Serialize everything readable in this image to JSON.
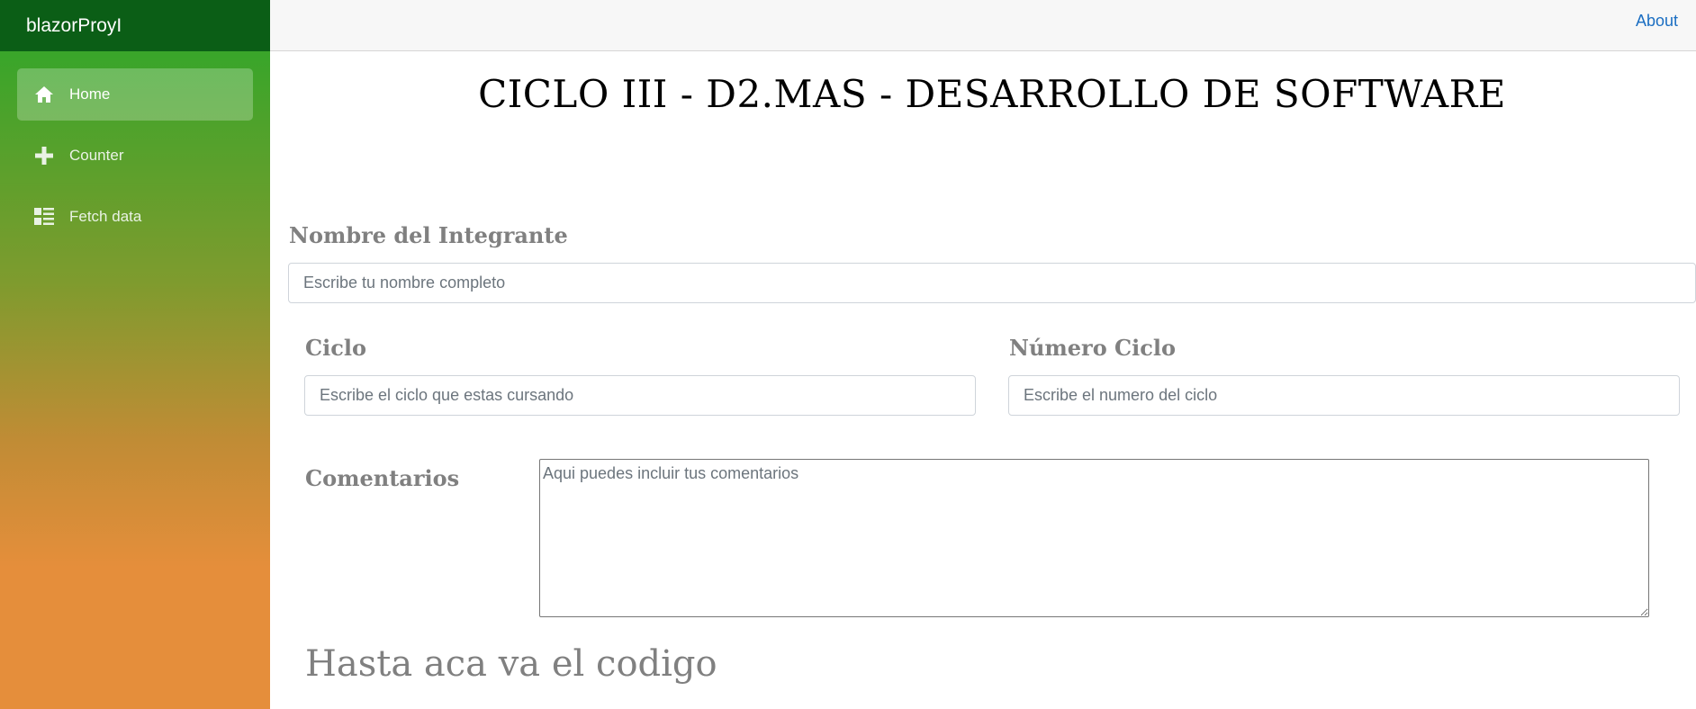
{
  "app": {
    "brand": "blazorProyI"
  },
  "sidebar": {
    "items": [
      {
        "label": "Home",
        "icon": "home-icon",
        "active": true
      },
      {
        "label": "Counter",
        "icon": "plus-icon",
        "active": false
      },
      {
        "label": "Fetch data",
        "icon": "list-icon",
        "active": false
      }
    ]
  },
  "topbar": {
    "about_label": "About"
  },
  "main": {
    "title": "CICLO III - D2.MAS - DESARROLLO DE SOFTWARE",
    "nombre": {
      "label": "Nombre del Integrante",
      "placeholder": "Escribe tu nombre completo",
      "value": ""
    },
    "ciclo": {
      "label": "Ciclo",
      "placeholder": "Escribe el ciclo que estas cursando",
      "value": ""
    },
    "numero_ciclo": {
      "label": "Número Ciclo",
      "placeholder": "Escribe el numero del ciclo",
      "value": ""
    },
    "comentarios": {
      "label": "Comentarios",
      "placeholder": "Aqui puedes incluir tus comentarios",
      "value": ""
    },
    "footer_heading": "Hasta aca va el codigo"
  },
  "colors": {
    "brand_bar": "#0b5e16",
    "sidebar_top": "#3aa52a",
    "sidebar_bottom": "#e58e3b",
    "link": "#1b6ec2",
    "label_gray": "#808080"
  }
}
